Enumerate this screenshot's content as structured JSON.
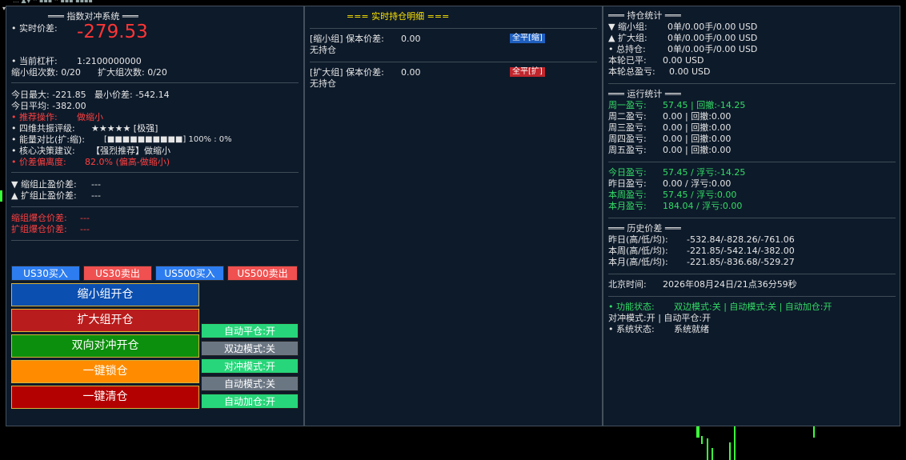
{
  "chart_ticker": "… ▲▼ ·· ▪▪▪ ·· ▪▪▪ ▪▪▪▪",
  "panel1": {
    "title": "═══ 指数对冲系统 ═══",
    "live_diff_label": "• 实时价差:",
    "live_diff_value": "-279.53",
    "leverage_label": "• 当前杠杆:",
    "leverage_value": "1:2100000000",
    "shrink_count": "缩小组次数: 0/20",
    "expand_count": "扩大组次数: 0/20",
    "today_max": "今日最大: -221.85",
    "min_diff": "最小价差: -542.14",
    "today_avg": "今日平均: -382.00",
    "suggest_label": "• 推荐操作:",
    "suggest_value": "做缩小",
    "resonance_label": "• 四维共振评级:",
    "resonance_value": "★★★★★ [极强]",
    "energy_label": "• 能量对比(扩:缩):",
    "energy_value": "[■■■■■■■■■■] 100% : 0%",
    "decision_label": "• 核心决策建议:",
    "decision_value": "【强烈推荐】做缩小",
    "deviation_label": "• 价差偏离度:",
    "deviation_value": "82.0% (偏高-做缩小)",
    "shrink_tp_label": "▼ 缩组止盈价差:",
    "shrink_tp_value": "---",
    "expand_tp_label": "▲ 扩组止盈价差:",
    "expand_tp_value": "---",
    "shrink_liq_label": "缩组爆仓价差:",
    "shrink_liq_value": "---",
    "expand_liq_label": "扩组爆仓价差:",
    "expand_liq_value": "---",
    "small_buttons": [
      "US30买入",
      "US30卖出",
      "US500买入",
      "US500卖出"
    ],
    "big_buttons": [
      "缩小组开仓",
      "扩大组开仓",
      "双向对冲开仓",
      "一键锁仓",
      "一键清仓"
    ],
    "toggle_buttons": [
      "自动平仓:开",
      "双边模式:关",
      "对冲模式:开",
      "自动模式:关",
      "自动加仓:开"
    ]
  },
  "panel2": {
    "title": "=== 实时持仓明细 ===",
    "shrink_label": "[缩小组] 保本价差:",
    "shrink_value": "0.00",
    "shrink_close_btn": "全平[缩]",
    "shrink_empty": "无持仓",
    "expand_label": "[扩大组] 保本价差:",
    "expand_value": "0.00",
    "expand_close_btn": "全平[扩]",
    "expand_empty": "无持仓"
  },
  "panel3": {
    "pos_title": "═══ 持仓统计 ═══",
    "pos_rows": [
      {
        "label": "▼ 缩小组:",
        "value": "0单/0.00手/0.00 USD"
      },
      {
        "label": "▲ 扩大组:",
        "value": "0单/0.00手/0.00 USD"
      },
      {
        "label": "• 总持仓:",
        "value": "0单/0.00手/0.00 USD"
      }
    ],
    "round_closed_label": "本轮已平:",
    "round_closed_value": "0.00 USD",
    "round_total_label": "本轮总盈亏:",
    "round_total_value": "0.00 USD",
    "run_title": "═══ 运行统计 ═══",
    "week_rows": [
      {
        "label": "周一盈亏:",
        "value": "57.45 | 回撤:-14.25"
      },
      {
        "label": "周二盈亏:",
        "value": "0.00 | 回撤:0.00"
      },
      {
        "label": "周三盈亏:",
        "value": "0.00 | 回撤:0.00"
      },
      {
        "label": "周四盈亏:",
        "value": "0.00 | 回撤:0.00"
      },
      {
        "label": "周五盈亏:",
        "value": "0.00 | 回撤:0.00"
      }
    ],
    "pnl_rows": [
      {
        "label": "今日盈亏:",
        "value": "57.45 / 浮亏:-14.25"
      },
      {
        "label": "昨日盈亏:",
        "value": "0.00 / 浮亏:0.00"
      },
      {
        "label": "本周盈亏:",
        "value": "57.45 / 浮亏:0.00"
      },
      {
        "label": "本月盈亏:",
        "value": "184.04 / 浮亏:0.00"
      }
    ],
    "hist_title": "═══ 历史价差 ═══",
    "hist_rows": [
      {
        "label": "昨日(高/低/均):",
        "value": "-532.84/-828.26/-761.06"
      },
      {
        "label": "本周(高/低/均):",
        "value": "-221.85/-542.14/-382.00"
      },
      {
        "label": "本月(高/低/均):",
        "value": "-221.85/-836.68/-529.27"
      }
    ],
    "bj_time_label": "北京时间:",
    "bj_time_value": "2026年08月24日/21点36分59秒",
    "func_label": "• 功能状态:",
    "func_value": "双边模式:关 | 自动模式:关 | 自动加仓:开",
    "hedge_line": "对冲模式:开 | 自动平仓:开",
    "sys_label": "• 系统状态:",
    "sys_value": "系统就绪"
  },
  "colors": {
    "panel_bg": "#0d1a2a",
    "green": "#33dd66",
    "red": "#ff4040",
    "yellow": "#ffe600",
    "blue_btn": "#2d7df0",
    "red_btn": "#f05050",
    "toggle_green": "#27d67a",
    "toggle_gray": "#6b7683"
  }
}
